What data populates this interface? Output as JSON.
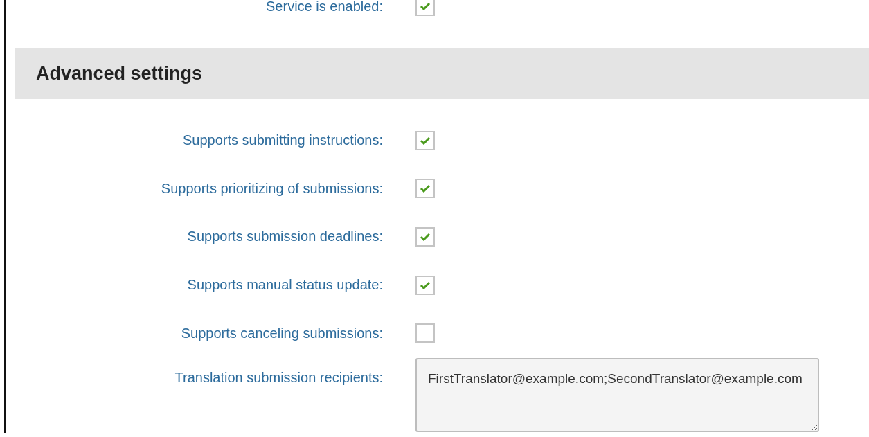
{
  "top_field": {
    "label": "Service is enabled:",
    "checked": true
  },
  "section": {
    "title": "Advanced settings"
  },
  "fields": [
    {
      "kind": "checkbox",
      "label": "Supports submitting instructions:",
      "checked": true
    },
    {
      "kind": "checkbox",
      "label": "Supports prioritizing of submissions:",
      "checked": true
    },
    {
      "kind": "checkbox",
      "label": "Supports submission deadlines:",
      "checked": true
    },
    {
      "kind": "checkbox",
      "label": "Supports manual status update:",
      "checked": true
    },
    {
      "kind": "checkbox",
      "label": "Supports canceling submissions:",
      "checked": false
    },
    {
      "kind": "textarea",
      "label": "Translation submission recipients:",
      "value": "FirstTranslator@example.com;SecondTranslator@example.com"
    }
  ]
}
